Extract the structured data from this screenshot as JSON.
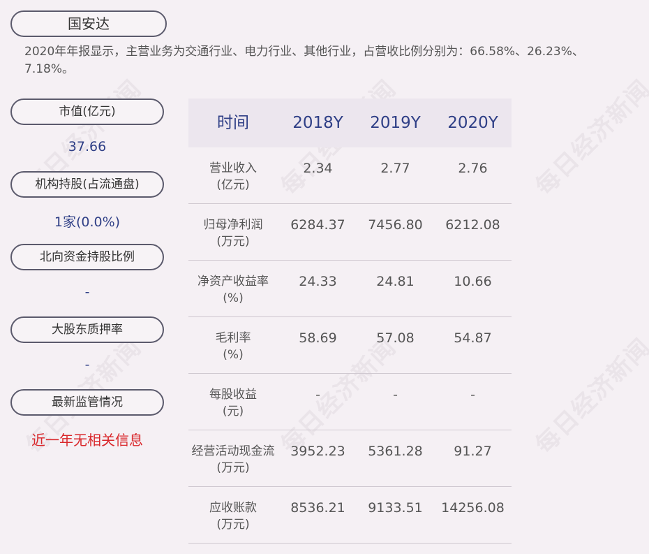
{
  "company": {
    "name": "国安达"
  },
  "summary": "2020年年报显示，主营业务为交通行业、电力行业、其他行业，占营收比例分别为：66.58%、26.23%、7.18%。",
  "sidebar": {
    "market_cap_label": "市值(亿元)",
    "market_cap_value": "37.66",
    "institution_label": "机构持股(占流通盘)",
    "institution_value": "1家(0.0%)",
    "northbound_label": "北向资金持股比例",
    "northbound_value": "-",
    "pledge_label": "大股东质押率",
    "pledge_value": "-",
    "regulation_label": "最新监管情况",
    "regulation_value": "近一年无相关信息"
  },
  "table": {
    "headers": [
      "时间",
      "2018Y",
      "2019Y",
      "2020Y"
    ],
    "rows": [
      {
        "label1": "营业收入",
        "label2": "(亿元)",
        "values": [
          "2.34",
          "2.77",
          "2.76"
        ]
      },
      {
        "label1": "归母净利润",
        "label2": "(万元)",
        "values": [
          "6284.37",
          "7456.80",
          "6212.08"
        ]
      },
      {
        "label1": "净资产收益率",
        "label2": "(%)",
        "values": [
          "24.33",
          "24.81",
          "10.66"
        ]
      },
      {
        "label1": "毛利率",
        "label2": "(%)",
        "values": [
          "58.69",
          "57.08",
          "54.87"
        ]
      },
      {
        "label1": "每股收益",
        "label2": "(元)",
        "values": [
          "-",
          "-",
          "-"
        ]
      },
      {
        "label1": "经营活动现金流",
        "label2": "(万元)",
        "values": [
          "3952.23",
          "5361.28",
          "91.27"
        ]
      },
      {
        "label1": "应收账款",
        "label2": "(万元)",
        "values": [
          "8536.21",
          "9133.51",
          "14256.08"
        ]
      }
    ]
  },
  "watermark": "每日经济新闻",
  "colors": {
    "background": "#f5f0f4",
    "accent_blue": "#2f3f86",
    "alert_red": "#d9272b",
    "header_bg": "#ece6ee"
  }
}
